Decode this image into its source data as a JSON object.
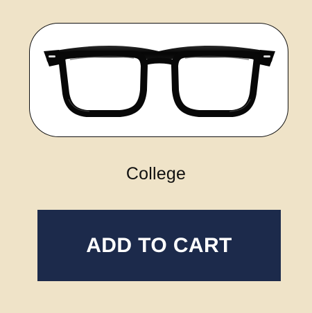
{
  "product": {
    "image_icon": "eyeglasses-icon",
    "name": "College"
  },
  "actions": {
    "add_to_cart_label": "ADD TO CART"
  },
  "colors": {
    "background": "#efe3c8",
    "card_background": "#ffffff",
    "button_background": "#1c2a4b",
    "button_text": "#ffffff",
    "frame_color": "#0b0b0b"
  }
}
